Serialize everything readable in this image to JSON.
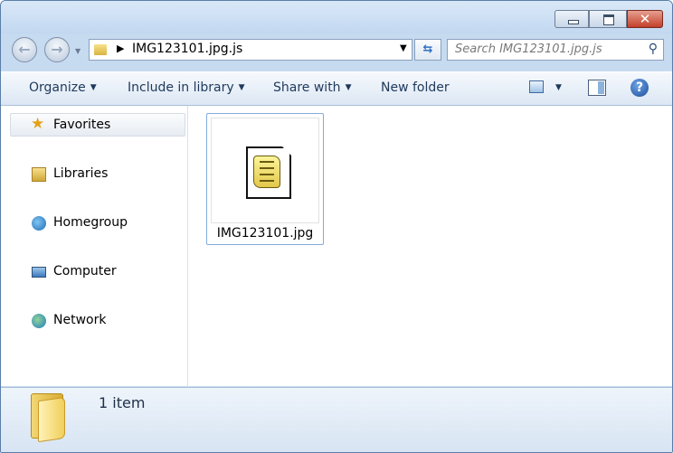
{
  "window": {
    "controls": {
      "minimize": "",
      "maximize": "",
      "close": "✕"
    }
  },
  "navigation": {
    "back_icon": "←",
    "forward_icon": "→",
    "address_path": "IMG123101.jpg.js",
    "search_placeholder": "Search IMG123101.jpg.js"
  },
  "toolbar": {
    "organize": "Organize",
    "include_in_library": "Include in library",
    "share_with": "Share with",
    "new_folder": "New folder",
    "help": "?"
  },
  "sidebar": {
    "items": [
      {
        "label": "Favorites",
        "icon": "star-icon"
      },
      {
        "label": "Libraries",
        "icon": "libraries-icon"
      },
      {
        "label": "Homegroup",
        "icon": "homegroup-icon"
      },
      {
        "label": "Computer",
        "icon": "computer-icon"
      },
      {
        "label": "Network",
        "icon": "network-icon"
      }
    ]
  },
  "files": [
    {
      "name": "IMG123101.jpg",
      "icon": "script-file-icon"
    }
  ],
  "status": {
    "count": "1 item"
  }
}
